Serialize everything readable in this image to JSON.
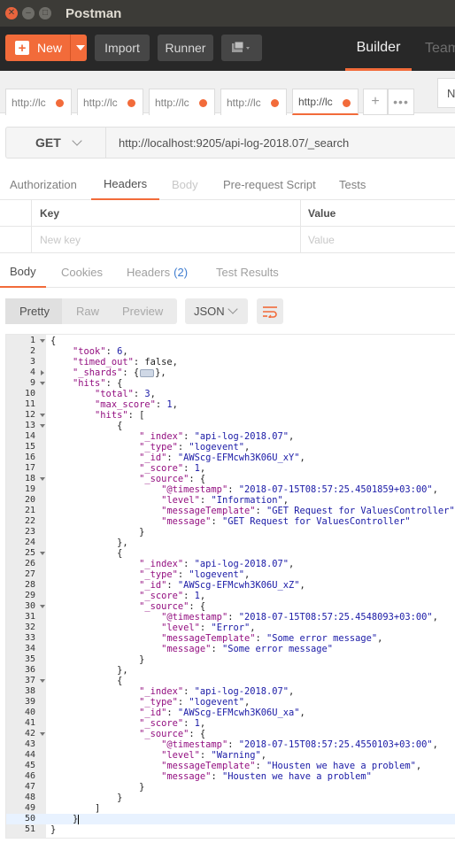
{
  "window": {
    "title": "Postman"
  },
  "toolbar": {
    "new_label": "New",
    "import_label": "Import",
    "runner_label": "Runner",
    "builder_label": "Builder",
    "team_label": "Team"
  },
  "request_tabs": [
    "http://lc",
    "http://lc",
    "http://lc",
    "http://lc",
    "http://lc"
  ],
  "environment": {
    "label": "N"
  },
  "request": {
    "method": "GET",
    "url": "http://localhost:9205/api-log-2018.07/_search"
  },
  "request_sections": [
    "Authorization",
    "Headers",
    "Body",
    "Pre-request Script",
    "Tests"
  ],
  "headers_table": {
    "key_header": "Key",
    "value_header": "Value",
    "key_placeholder": "New key",
    "value_placeholder": "Value"
  },
  "response_tabs": {
    "body": "Body",
    "cookies": "Cookies",
    "headers": "Headers",
    "headers_count": "(2)",
    "tests": "Test Results"
  },
  "response_toolbar": {
    "pretty": "Pretty",
    "raw": "Raw",
    "preview": "Preview",
    "format": "JSON"
  },
  "code_lines": [
    {
      "n": "1",
      "fold": "open",
      "html": "{"
    },
    {
      "n": "2",
      "fold": "",
      "html": "    <span class='k'>\"took\"</span>: <span class='n'>6</span>,"
    },
    {
      "n": "3",
      "fold": "",
      "html": "    <span class='k'>\"timed_out\"</span>: <span class='b'>false</span>,"
    },
    {
      "n": "4",
      "fold": "closed",
      "html": "    <span class='k'>\"_shards\"</span>: {<span class='ell'></span>},"
    },
    {
      "n": "9",
      "fold": "open",
      "html": "    <span class='k'>\"hits\"</span>: {"
    },
    {
      "n": "10",
      "fold": "",
      "html": "        <span class='k'>\"total\"</span>: <span class='n'>3</span>,"
    },
    {
      "n": "11",
      "fold": "",
      "html": "        <span class='k'>\"max_score\"</span>: <span class='n'>1</span>,"
    },
    {
      "n": "12",
      "fold": "open",
      "html": "        <span class='k'>\"hits\"</span>: ["
    },
    {
      "n": "13",
      "fold": "open",
      "html": "            {"
    },
    {
      "n": "14",
      "fold": "",
      "html": "                <span class='k'>\"_index\"</span>: <span class='s'>\"api-log-2018.07\"</span>,"
    },
    {
      "n": "15",
      "fold": "",
      "html": "                <span class='k'>\"_type\"</span>: <span class='s'>\"logevent\"</span>,"
    },
    {
      "n": "16",
      "fold": "",
      "html": "                <span class='k'>\"_id\"</span>: <span class='s'>\"AWScg-EFMcwh3K06U_xY\"</span>,"
    },
    {
      "n": "17",
      "fold": "",
      "html": "                <span class='k'>\"_score\"</span>: <span class='n'>1</span>,"
    },
    {
      "n": "18",
      "fold": "open",
      "html": "                <span class='k'>\"_source\"</span>: {"
    },
    {
      "n": "19",
      "fold": "",
      "html": "                    <span class='k'>\"@timestamp\"</span>: <span class='s'>\"2018-07-15T08:57:25.4501859+03:00\"</span>,"
    },
    {
      "n": "20",
      "fold": "",
      "html": "                    <span class='k'>\"level\"</span>: <span class='s'>\"Information\"</span>,"
    },
    {
      "n": "21",
      "fold": "",
      "html": "                    <span class='k'>\"messageTemplate\"</span>: <span class='s'>\"GET Request for ValuesController\"</span>,"
    },
    {
      "n": "22",
      "fold": "",
      "html": "                    <span class='k'>\"message\"</span>: <span class='s'>\"GET Request for ValuesController\"</span>"
    },
    {
      "n": "23",
      "fold": "",
      "html": "                }"
    },
    {
      "n": "24",
      "fold": "",
      "html": "            },"
    },
    {
      "n": "25",
      "fold": "open",
      "html": "            {"
    },
    {
      "n": "26",
      "fold": "",
      "html": "                <span class='k'>\"_index\"</span>: <span class='s'>\"api-log-2018.07\"</span>,"
    },
    {
      "n": "27",
      "fold": "",
      "html": "                <span class='k'>\"_type\"</span>: <span class='s'>\"logevent\"</span>,"
    },
    {
      "n": "28",
      "fold": "",
      "html": "                <span class='k'>\"_id\"</span>: <span class='s'>\"AWScg-EFMcwh3K06U_xZ\"</span>,"
    },
    {
      "n": "29",
      "fold": "",
      "html": "                <span class='k'>\"_score\"</span>: <span class='n'>1</span>,"
    },
    {
      "n": "30",
      "fold": "open",
      "html": "                <span class='k'>\"_source\"</span>: {"
    },
    {
      "n": "31",
      "fold": "",
      "html": "                    <span class='k'>\"@timestamp\"</span>: <span class='s'>\"2018-07-15T08:57:25.4548093+03:00\"</span>,"
    },
    {
      "n": "32",
      "fold": "",
      "html": "                    <span class='k'>\"level\"</span>: <span class='s'>\"Error\"</span>,"
    },
    {
      "n": "33",
      "fold": "",
      "html": "                    <span class='k'>\"messageTemplate\"</span>: <span class='s'>\"Some error message\"</span>,"
    },
    {
      "n": "34",
      "fold": "",
      "html": "                    <span class='k'>\"message\"</span>: <span class='s'>\"Some error message\"</span>"
    },
    {
      "n": "35",
      "fold": "",
      "html": "                }"
    },
    {
      "n": "36",
      "fold": "",
      "html": "            },"
    },
    {
      "n": "37",
      "fold": "open",
      "html": "            {"
    },
    {
      "n": "38",
      "fold": "",
      "html": "                <span class='k'>\"_index\"</span>: <span class='s'>\"api-log-2018.07\"</span>,"
    },
    {
      "n": "39",
      "fold": "",
      "html": "                <span class='k'>\"_type\"</span>: <span class='s'>\"logevent\"</span>,"
    },
    {
      "n": "40",
      "fold": "",
      "html": "                <span class='k'>\"_id\"</span>: <span class='s'>\"AWScg-EFMcwh3K06U_xa\"</span>,"
    },
    {
      "n": "41",
      "fold": "",
      "html": "                <span class='k'>\"_score\"</span>: <span class='n'>1</span>,"
    },
    {
      "n": "42",
      "fold": "open",
      "html": "                <span class='k'>\"_source\"</span>: {"
    },
    {
      "n": "43",
      "fold": "",
      "html": "                    <span class='k'>\"@timestamp\"</span>: <span class='s'>\"2018-07-15T08:57:25.4550103+03:00\"</span>,"
    },
    {
      "n": "44",
      "fold": "",
      "html": "                    <span class='k'>\"level\"</span>: <span class='s'>\"Warning\"</span>,"
    },
    {
      "n": "45",
      "fold": "",
      "html": "                    <span class='k'>\"messageTemplate\"</span>: <span class='s'>\"Housten we have a problem\"</span>,"
    },
    {
      "n": "46",
      "fold": "",
      "html": "                    <span class='k'>\"message\"</span>: <span class='s'>\"Housten we have a problem\"</span>"
    },
    {
      "n": "47",
      "fold": "",
      "html": "                }"
    },
    {
      "n": "48",
      "fold": "",
      "html": "            }"
    },
    {
      "n": "49",
      "fold": "",
      "html": "        ]"
    },
    {
      "n": "50",
      "fold": "",
      "html": "    }<span class='caretc'></span>",
      "current": true
    },
    {
      "n": "51",
      "fold": "",
      "html": "}"
    }
  ],
  "colors": {
    "accent": "#f26b3a",
    "titlebar": "#3c3b37",
    "toolbar": "#282828",
    "json_key": "#930f80",
    "json_value": "#1a1aa6"
  }
}
